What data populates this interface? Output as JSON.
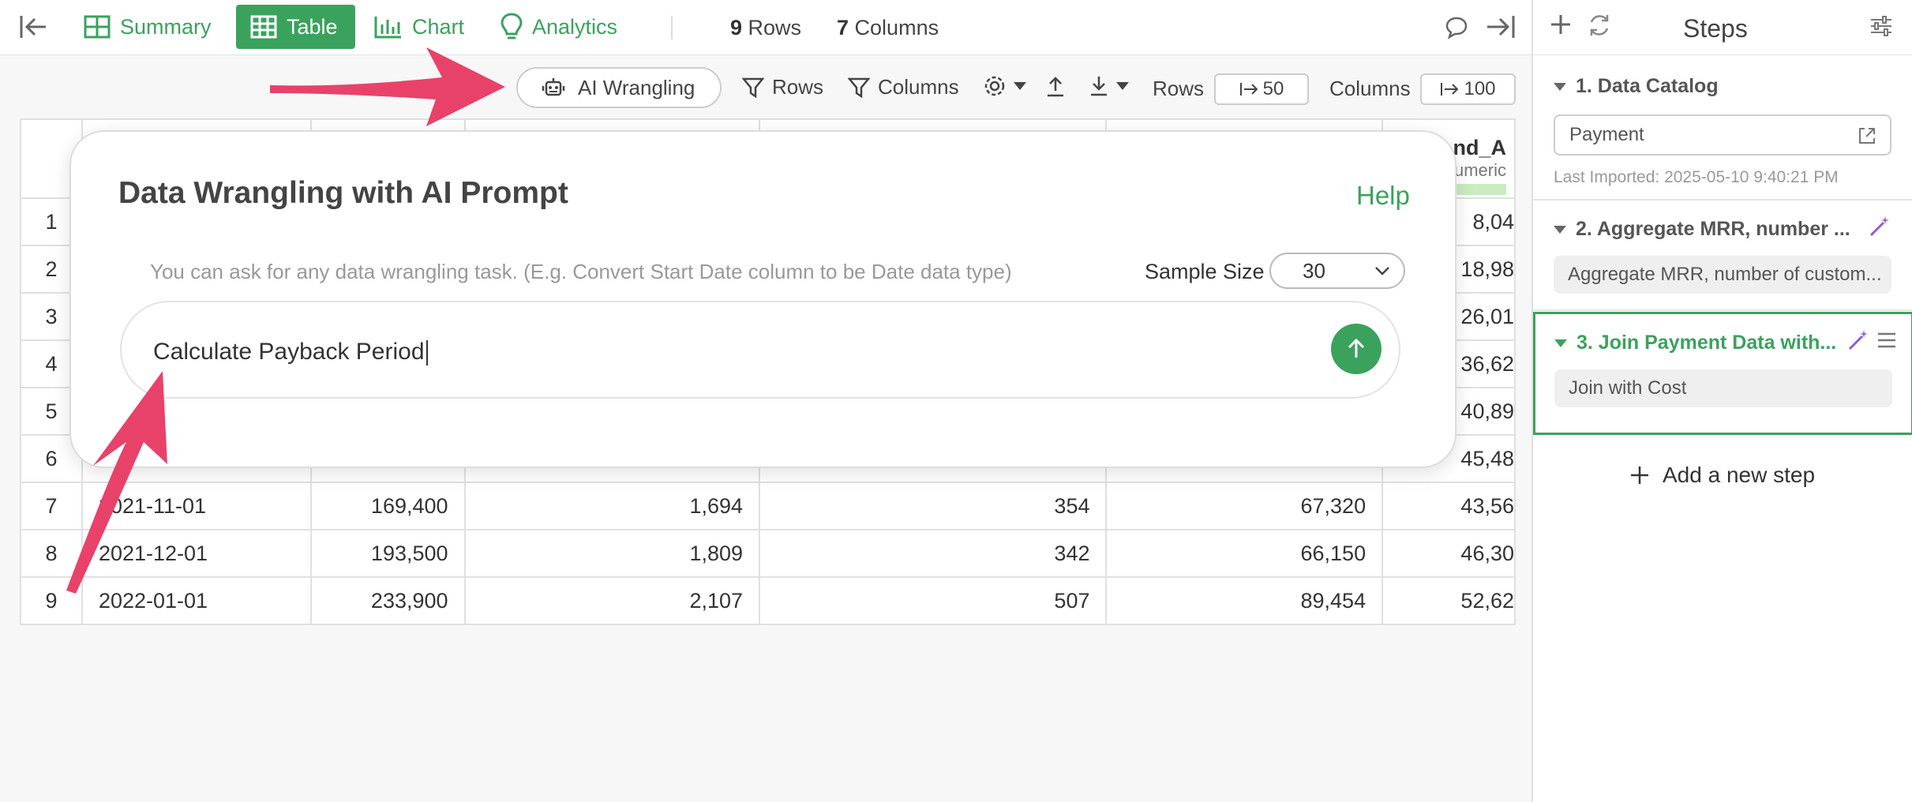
{
  "topbar": {
    "tabs": [
      {
        "label": "Summary",
        "icon": "summary-grid-icon"
      },
      {
        "label": "Table",
        "icon": "table-icon"
      },
      {
        "label": "Chart",
        "icon": "bar-chart-icon"
      },
      {
        "label": "Analytics",
        "icon": "lightbulb-icon"
      }
    ],
    "rows_count": "9",
    "rows_label": "Rows",
    "columns_count": "7",
    "columns_label": "Columns"
  },
  "toolbar": {
    "ai_wrangling_label": "AI Wrangling",
    "rows_filter_label": "Rows",
    "columns_filter_label": "Columns",
    "rows_label": "Rows",
    "rows_value": "50",
    "columns_label": "Columns",
    "columns_value": "100"
  },
  "table": {
    "header_partial": {
      "name": "nd_A",
      "type": "umeric"
    },
    "rows": [
      {
        "idx": "1",
        "c1": "",
        "c2": "",
        "c3": "",
        "c4": "",
        "c5": "",
        "c6": "8,04"
      },
      {
        "idx": "2",
        "c1": "",
        "c2": "",
        "c3": "",
        "c4": "",
        "c5": "",
        "c6": "18,98"
      },
      {
        "idx": "3",
        "c1": "",
        "c2": "",
        "c3": "",
        "c4": "",
        "c5": "",
        "c6": "26,01"
      },
      {
        "idx": "4",
        "c1": "",
        "c2": "",
        "c3": "",
        "c4": "",
        "c5": "",
        "c6": "36,62"
      },
      {
        "idx": "5",
        "c1": "",
        "c2": "",
        "c3": "",
        "c4": "",
        "c5": "",
        "c6": "40,89"
      },
      {
        "idx": "6",
        "c1": "",
        "c2": "",
        "c3": "",
        "c4": "",
        "c5": "",
        "c6": "45,48"
      },
      {
        "idx": "7",
        "c1": "2021-11-01",
        "c2": "169,400",
        "c3": "1,694",
        "c4": "354",
        "c5": "67,320",
        "c6": "43,56"
      },
      {
        "idx": "8",
        "c1": "2021-12-01",
        "c2": "193,500",
        "c3": "1,809",
        "c4": "342",
        "c5": "66,150",
        "c6": "46,30"
      },
      {
        "idx": "9",
        "c1": "2022-01-01",
        "c2": "233,900",
        "c3": "2,107",
        "c4": "507",
        "c5": "89,454",
        "c6": "52,62"
      }
    ]
  },
  "modal": {
    "title": "Data Wrangling with AI Prompt",
    "help": "Help",
    "hint": "You can ask for any data wrangling task. (E.g. Convert Start Date column to be Date data type)",
    "sample_size_label": "Sample Size",
    "sample_size_value": "30",
    "prompt_value": "Calculate Payback Period"
  },
  "sidebar": {
    "title": "Steps",
    "steps": [
      {
        "title": "1. Data Catalog",
        "content": "Payment",
        "subtext": "Last Imported: 2025-05-10 9:40:21 PM"
      },
      {
        "title": "2. Aggregate MRR, number ...",
        "content": "Aggregate MRR, number of custom..."
      },
      {
        "title": "3. Join Payment Data with...",
        "content": "Join with Cost"
      }
    ],
    "add_step_label": "Add a new step"
  },
  "colors": {
    "accent": "#3aa25d",
    "annotation_arrow": "#e8426a",
    "magic_wand": "#8b5cd6"
  }
}
